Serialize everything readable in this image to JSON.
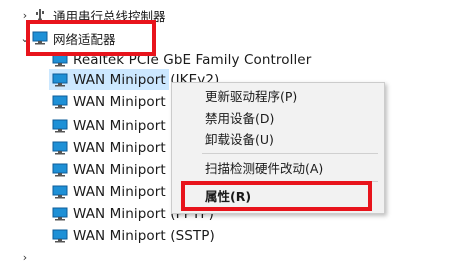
{
  "tree": {
    "usb_category": "通用串行总线控制器",
    "net_category": "网络适配器",
    "devices": [
      "Realtek PCIe GbE Family Controller",
      "WAN Miniport (IKEv2)",
      "WAN Miniport (",
      "WAN Miniport (",
      "WAN Miniport (",
      "WAN Miniport (",
      "WAN Miniport (",
      "WAN Miniport (PPTP)",
      "WAN Miniport (SSTP)"
    ],
    "expander_collapsed": "chevron-right-icon",
    "expander_expanded": "chevron-down-icon"
  },
  "context_menu": {
    "update_driver": "更新驱动程序(P)",
    "disable_device": "禁用设备(D)",
    "uninstall_device": "卸载设备(U)",
    "scan_hardware": "扫描检测硬件改动(A)",
    "properties": "属性(R)"
  },
  "colors": {
    "selection": "#cce8ff",
    "annotation_red": "#e8141c",
    "menu_bg": "#f2f2f2",
    "network_icon": "#1e90d6"
  }
}
